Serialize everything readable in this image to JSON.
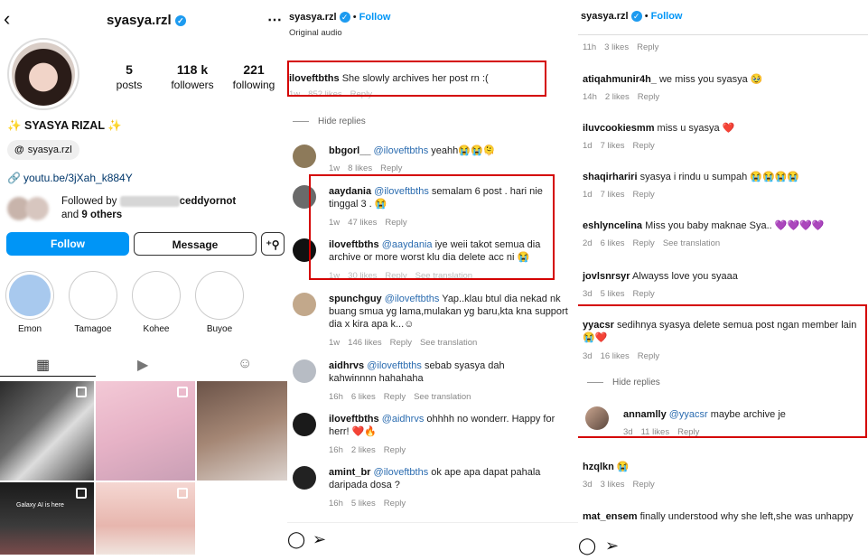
{
  "profile": {
    "username": "syasya.rzl",
    "posts_count": "5",
    "posts_label": "posts",
    "followers_count": "118 k",
    "followers_label": "followers",
    "following_count": "221",
    "following_label": "following",
    "display_name": "✨ SYASYA RIZAL ✨",
    "threads_handle": "syasya.rzl",
    "link": "youtu.be/3jXah_k884Y",
    "followed_by_prefix": "Followed by",
    "followed_by_name": "ceddyornot",
    "followed_by_suffix_1": "and",
    "followed_by_others": "9 others",
    "follow_label": "Follow",
    "message_label": "Message",
    "highlights": [
      "Emon",
      "Tamagoe",
      "Kohee",
      "Buyoe"
    ],
    "grid_caption": "Galaxy AI is here"
  },
  "reel_header": {
    "username": "syasya.rzl",
    "dot": "•",
    "follow": "Follow",
    "subtitle": "Original audio"
  },
  "panel2": {
    "top_comment": {
      "user": "iloveftbths",
      "text": "She slowly archives her post rn :(",
      "time": "1w",
      "likes": "852 likes",
      "reply": "Reply"
    },
    "hide_replies": "Hide replies",
    "comments": [
      {
        "user": "bbgorl__",
        "mention": "@iloveftbths",
        "text": "yeahh😭😭🫠",
        "time": "1w",
        "likes": "8 likes",
        "reply": "Reply",
        "translation": ""
      },
      {
        "user": "aaydania",
        "mention": "@iloveftbths",
        "text": "semalam 6 post . hari nie tinggal 3 . 😭",
        "time": "1w",
        "likes": "47 likes",
        "reply": "Reply",
        "translation": ""
      },
      {
        "user": "iloveftbths",
        "mention": "@aaydania",
        "text": "iye weii takot semua dia archive or more worst klu dia delete acc ni 😭",
        "time": "1w",
        "likes": "30 likes",
        "reply": "Reply",
        "translation": "See translation"
      },
      {
        "user": "spunchguy",
        "mention": "@iloveftbths",
        "text": "Yap..klau btul dia nekad nk buang smua yg lama,mulakan yg baru,kta kna support dia x kira apa k...☺",
        "time": "1w",
        "likes": "146 likes",
        "reply": "Reply",
        "translation": "See translation"
      },
      {
        "user": "aidhrvs",
        "mention": "@iloveftbths",
        "text": "sebab syasya dah kahwinnnn hahahaha",
        "time": "16h",
        "likes": "6 likes",
        "reply": "Reply",
        "translation": "See translation"
      },
      {
        "user": "iloveftbths",
        "mention": "@aidhrvs",
        "text": "ohhhh no wonderr. Happy for herr! ❤️🔥",
        "time": "16h",
        "likes": "2 likes",
        "reply": "Reply",
        "translation": ""
      },
      {
        "user": "amint_br",
        "mention": "@iloveftbths",
        "text": "ok ape apa dapat pahala daripada dosa ?",
        "time": "16h",
        "likes": "5 likes",
        "reply": "Reply",
        "translation": ""
      }
    ]
  },
  "panel3": {
    "first_meta": {
      "time": "11h",
      "likes": "3 likes",
      "reply": "Reply"
    },
    "comments": [
      {
        "user": "atiqahmunir4h_",
        "text": "we miss you syasya 🥹",
        "time": "14h",
        "likes": "2 likes",
        "reply": "Reply",
        "translation": ""
      },
      {
        "user": "iluvcookiesmm",
        "text": "miss u syasya ❤️",
        "time": "1d",
        "likes": "7 likes",
        "reply": "Reply",
        "translation": ""
      },
      {
        "user": "shaqirhariri",
        "text": "syasya i rindu u sumpah 😭😭😭😭",
        "time": "1d",
        "likes": "7 likes",
        "reply": "Reply",
        "translation": ""
      },
      {
        "user": "eshlyncelina",
        "text": "Miss you baby maknae Sya.. 💜💜💜💜",
        "time": "2d",
        "likes": "6 likes",
        "reply": "Reply",
        "translation": "See translation"
      },
      {
        "user": "jovlsnrsyr",
        "text": "Alwayss love you syaaa",
        "time": "3d",
        "likes": "5 likes",
        "reply": "Reply",
        "translation": ""
      },
      {
        "user": "yyacsr",
        "text": "sedihnya syasya delete semua post ngan member lain 😭❤️",
        "time": "3d",
        "likes": "16 likes",
        "reply": "Reply",
        "translation": ""
      }
    ],
    "hide_replies": "Hide replies",
    "reply": {
      "user": "annamlly",
      "mention": "@yyacsr",
      "text": "maybe archive je",
      "time": "3d",
      "likes": "11 likes",
      "reply": "Reply"
    },
    "after": [
      {
        "user": "hzqlkn",
        "text": "😭",
        "time": "3d",
        "likes": "3 likes",
        "reply": "Reply"
      },
      {
        "user": "mat_ensem",
        "text": "finally understood why she left,she was unhappy"
      }
    ]
  },
  "colors": {
    "accent": "#0095f6",
    "highlight_box": "#d40000",
    "link": "#2b6cb0"
  }
}
